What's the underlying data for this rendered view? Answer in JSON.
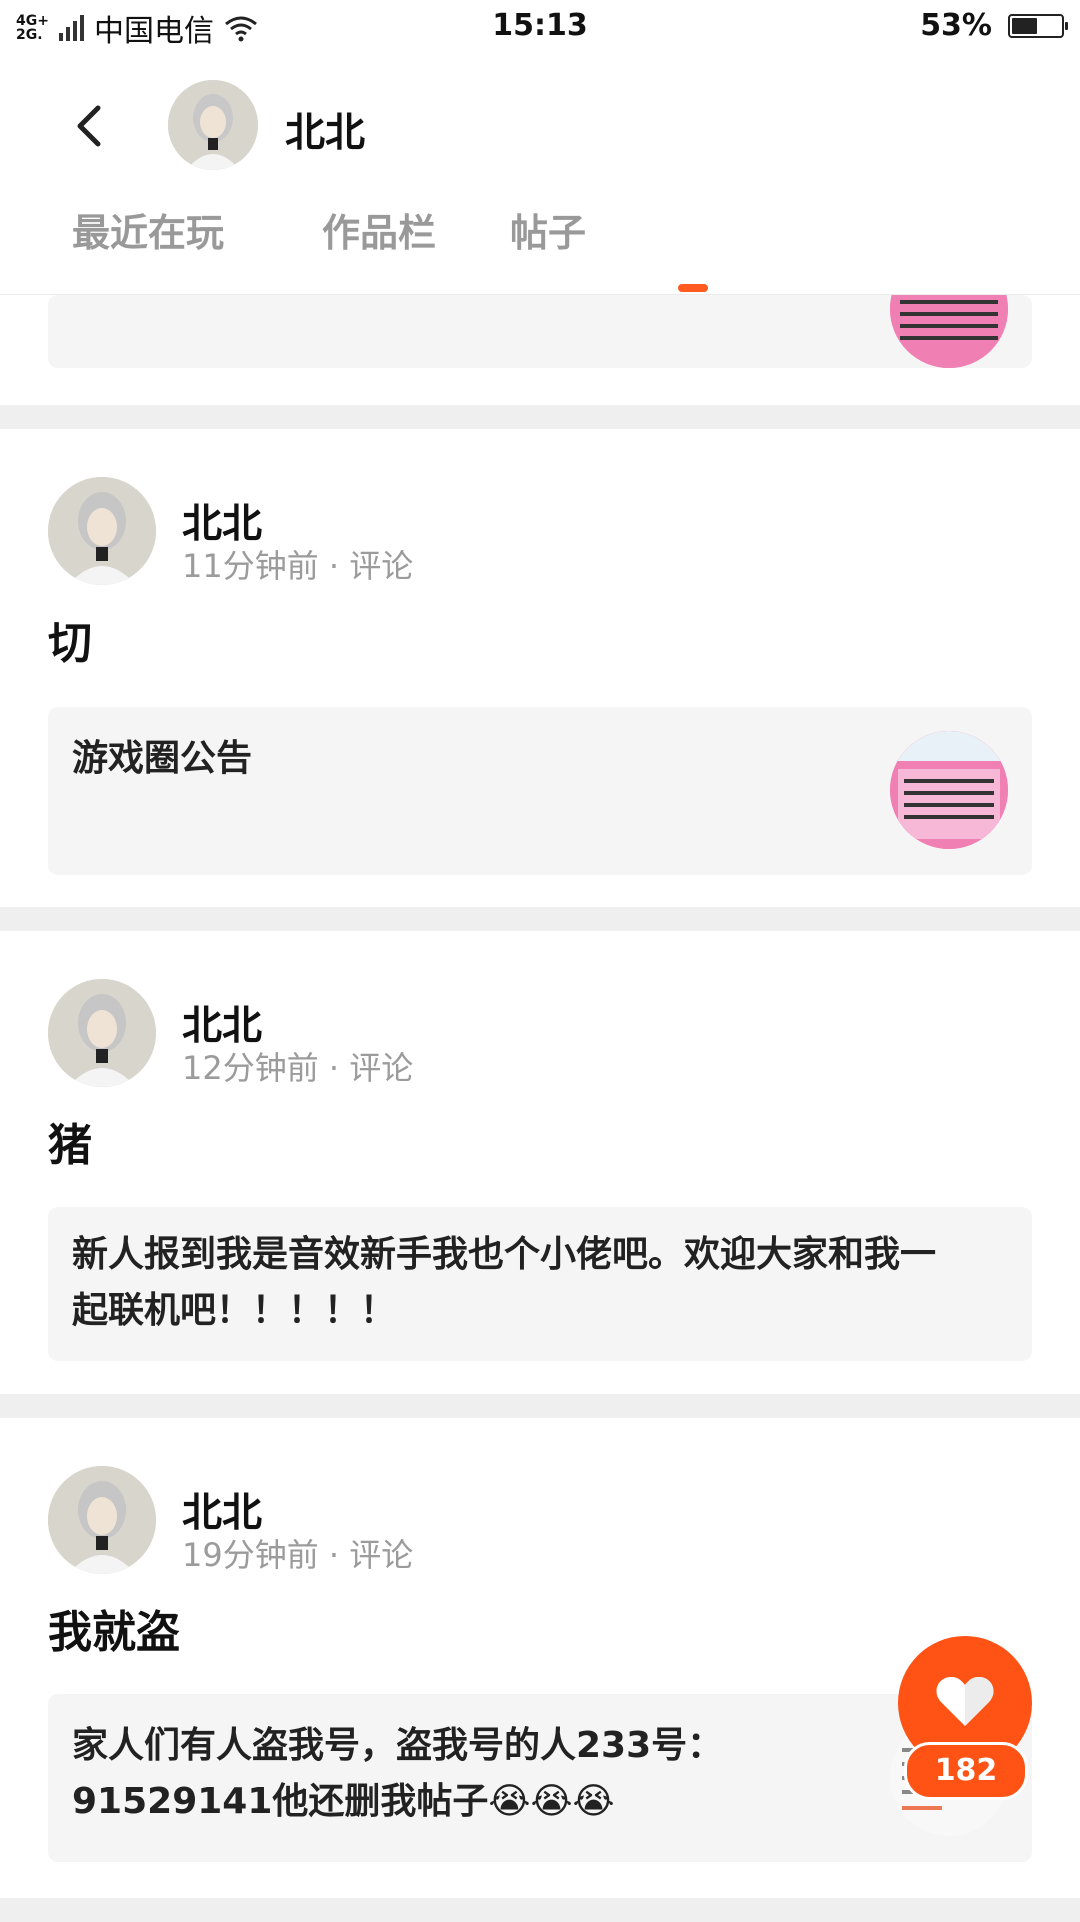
{
  "status_bar": {
    "network": "4G+\n2G",
    "carrier": "中国电信",
    "time": "15:13",
    "battery_text": "53%",
    "battery_level": 0.53
  },
  "header": {
    "title": "北北",
    "tabs": [
      {
        "label": "最近在玩"
      },
      {
        "label": "作品栏"
      },
      {
        "label": "帖子"
      }
    ],
    "accent": "#ff5a1f"
  },
  "posts": [
    {
      "user": "北北",
      "time": "11分钟前",
      "comment": "评论",
      "text": "切",
      "quote": "游戏圈公告",
      "has_thumb": true
    },
    {
      "user": "北北",
      "time": "12分钟前",
      "comment": "评论",
      "text": "猪",
      "quote": "新人报到我是音效新手我也个小佬吧。欢迎大家和我一起联机吧！！！！！",
      "has_thumb": false
    },
    {
      "user": "北北",
      "time": "19分钟前",
      "comment": "评论",
      "text": "我就盗",
      "quote": "家人们有人盗我号，盗我号的人233号：91529141他还删我帖子😭😭😭",
      "has_thumb": true
    }
  ],
  "like": {
    "count": "182"
  }
}
